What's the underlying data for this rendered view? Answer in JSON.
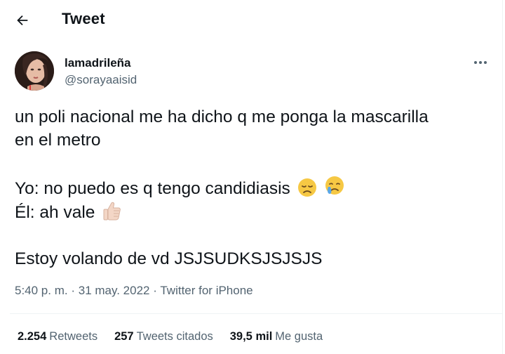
{
  "header": {
    "title": "Tweet",
    "back_icon": "arrow-left-icon"
  },
  "author": {
    "display_name": "lamadrileña",
    "handle": "@sorayaaisid",
    "more_icon": "more-horizontal-icon"
  },
  "tweet": {
    "line1": "un poli nacional me ha dicho q me ponga la mascarilla",
    "line2": "en el metro",
    "line3": "Yo: no puedo es q tengo candidiasis",
    "line3_emojis": [
      "disappointed-face-emoji",
      "crying-face-emoji"
    ],
    "line4": "Él: ah vale",
    "line4_emojis": [
      "thumbs-up-emoji"
    ],
    "line5": "Estoy volando de vd JSJSUDKSJSJSJS"
  },
  "meta": {
    "time": "5:40 p. m.",
    "date": "31 may. 2022",
    "source": "Twitter for iPhone",
    "separator": "·"
  },
  "stats": {
    "retweets_count": "2.254",
    "retweets_label": "Retweets",
    "quotes_count": "257",
    "quotes_label": "Tweets citados",
    "likes_count": "39,5 mil",
    "likes_label": "Me gusta"
  },
  "colors": {
    "text": "#0f1419",
    "secondary": "#536471",
    "divider": "#eff3f4",
    "emoji_yellow": "#f4c430"
  }
}
